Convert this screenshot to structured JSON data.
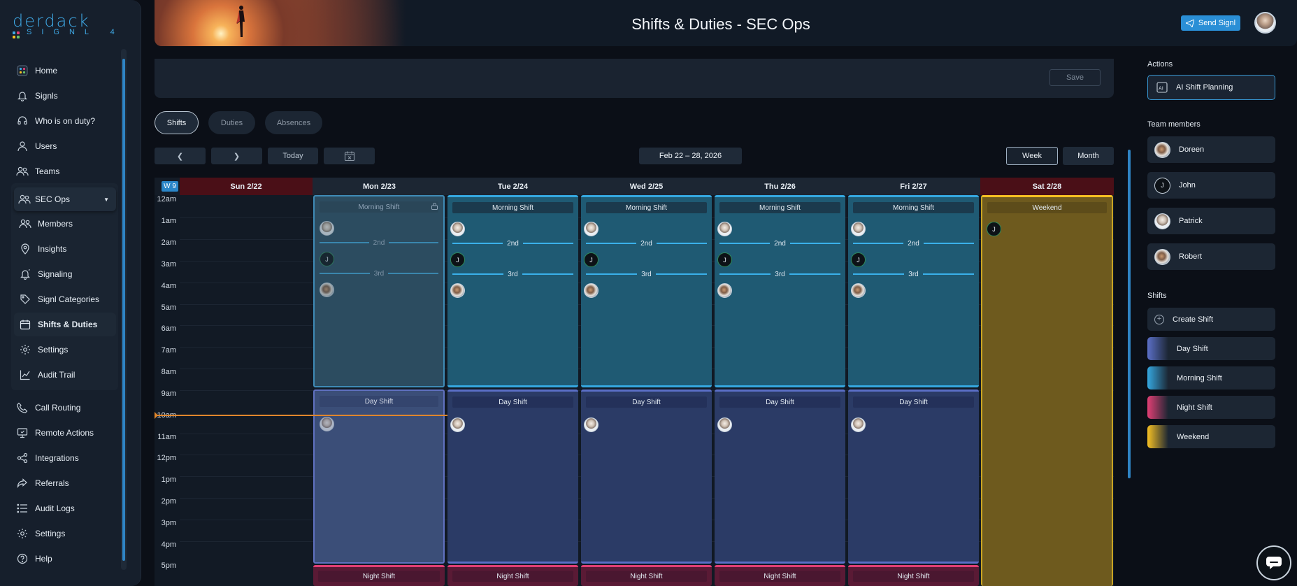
{
  "app": {
    "logo_main": "derdack",
    "logo_sub": "SIGNL 4"
  },
  "header": {
    "title": "Shifts & Duties - SEC Ops",
    "send_label": "Send Signl"
  },
  "sidebar": {
    "items": [
      {
        "label": "Home",
        "icon": "home-icon"
      },
      {
        "label": "Signls",
        "icon": "bell-icon"
      },
      {
        "label": "Who is on duty?",
        "icon": "headset-icon"
      },
      {
        "label": "Users",
        "icon": "user-icon"
      },
      {
        "label": "Teams",
        "icon": "users-icon"
      }
    ],
    "team": "SEC Ops",
    "team_items": [
      {
        "label": "Members",
        "icon": "users-icon"
      },
      {
        "label": "Insights",
        "icon": "location-pin-icon"
      },
      {
        "label": "Signaling",
        "icon": "bell-ring-icon"
      },
      {
        "label": "Signl Categories",
        "icon": "tag-icon"
      },
      {
        "label": "Shifts & Duties",
        "icon": "calendar-icon",
        "active": true
      },
      {
        "label": "Settings",
        "icon": "gear-icon"
      },
      {
        "label": "Audit Trail",
        "icon": "chart-icon"
      }
    ],
    "bottom_items": [
      {
        "label": "Call Routing",
        "icon": "phone-icon"
      },
      {
        "label": "Remote Actions",
        "icon": "remote-actions-icon"
      },
      {
        "label": "Integrations",
        "icon": "integrations-icon"
      },
      {
        "label": "Referrals",
        "icon": "share-icon"
      },
      {
        "label": "Audit Logs",
        "icon": "list-icon"
      },
      {
        "label": "Settings",
        "icon": "gear-icon"
      },
      {
        "label": "Help",
        "icon": "help-icon"
      }
    ]
  },
  "settings": {
    "save_label": "Save"
  },
  "tabs": [
    "Shifts",
    "Duties",
    "Absences"
  ],
  "toolbar": {
    "today_label": "Today",
    "date_range": "Feb 22 – 28, 2026",
    "week_label": "Week",
    "month_label": "Month"
  },
  "calendar": {
    "week_badge": "W 9",
    "days": [
      "Sun 2/22",
      "Mon 2/23",
      "Tue 2/24",
      "Wed 2/25",
      "Thu 2/26",
      "Fri 2/27",
      "Sat 2/28"
    ],
    "hours": [
      "12am",
      "1am",
      "2am",
      "3am",
      "4am",
      "5am",
      "6am",
      "7am",
      "8am",
      "9am",
      "10am",
      "11am",
      "12pm",
      "1pm",
      "2pm",
      "3pm",
      "4pm",
      "5pm"
    ],
    "shift_names": {
      "morning": "Morning Shift",
      "day": "Day Shift",
      "night": "Night Shift",
      "weekend": "Weekend"
    },
    "escalation": {
      "second": "2nd",
      "third": "3rd"
    },
    "initial_j": "J"
  },
  "right_panel": {
    "actions_title": "Actions",
    "ai_label": "AI Shift Planning",
    "team_title": "Team members",
    "members": [
      "Doreen",
      "John",
      "Patrick",
      "Robert"
    ],
    "member_initial": "J",
    "shifts_title": "Shifts",
    "create_label": "Create Shift",
    "shifts": [
      {
        "label": "Day Shift",
        "color": "#5b6fc7"
      },
      {
        "label": "Morning Shift",
        "color": "#35a8e0"
      },
      {
        "label": "Night Shift",
        "color": "#e23f74"
      },
      {
        "label": "Weekend",
        "color": "#f6c023"
      }
    ]
  },
  "colors": {
    "accent": "#2a8fd6",
    "morning": "#35a8e0",
    "day": "#5b6fc7",
    "night": "#e23f74",
    "weekend": "#f6c023",
    "sunday_header": "#4a0f17",
    "now_line": "#e0862c"
  }
}
